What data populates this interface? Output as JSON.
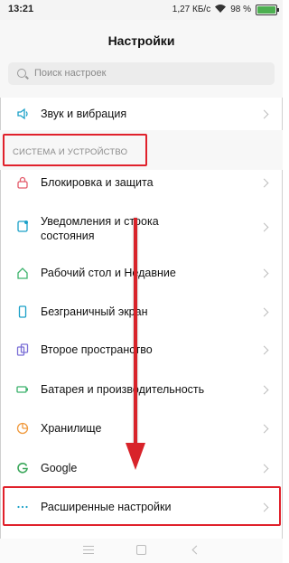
{
  "status_bar": {
    "time": "13:21",
    "speed": "1,27 КБ/с",
    "battery": "98 %",
    "battery_level": 0.98
  },
  "header": {
    "title": "Настройки"
  },
  "search": {
    "placeholder": "Поиск настроек"
  },
  "items": [
    {
      "label": "Звук и вибрация",
      "icon": "speaker-icon"
    },
    {
      "label": "Блокировка и защита",
      "icon": "lock-icon"
    },
    {
      "label": "Уведомления и строка\nсостояния",
      "icon": "notification-icon"
    },
    {
      "label": "Рабочий стол и Недавние",
      "icon": "home-icon"
    },
    {
      "label": "Безграничный экран",
      "icon": "phone-screen-icon"
    },
    {
      "label": "Второе пространство",
      "icon": "second-space-icon"
    },
    {
      "label": "Батарея и производительность",
      "icon": "battery-icon"
    },
    {
      "label": "Хранилище",
      "icon": "storage-pie-icon"
    },
    {
      "label": "Google",
      "icon": "google-icon"
    },
    {
      "label": "Расширенные настройки",
      "icon": "more-dots-icon"
    }
  ],
  "section": {
    "label": "СИСТЕМА И УСТРОЙСТВО"
  },
  "colors": {
    "accent": "#1aa0c8",
    "annotation": "#e0212b",
    "lock": "#e35a6a",
    "home_icon": "#3bb36b",
    "storage": "#f09a3e",
    "second_space": "#7b6fd6",
    "battery_icon": "#39b06a",
    "google": "#3aa75a"
  }
}
